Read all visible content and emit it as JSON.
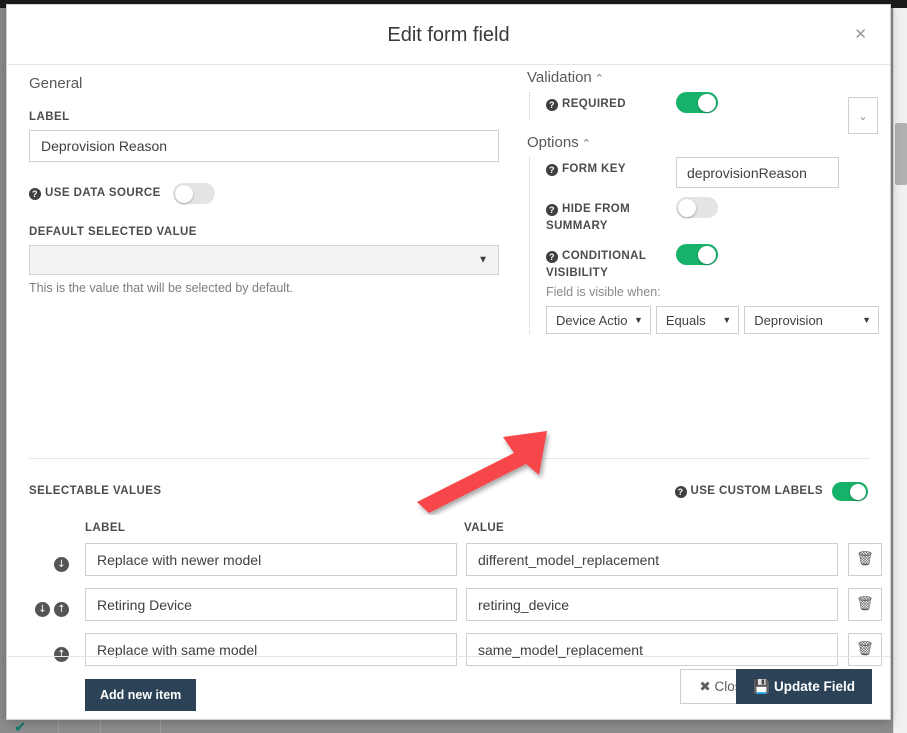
{
  "modal": {
    "title": "Edit form field",
    "close_icon": "close-x-icon"
  },
  "general": {
    "heading": "General",
    "label_caption": "LABEL",
    "label_value": "Deprovision Reason",
    "use_data_source_caption": "USE DATA SOURCE",
    "use_data_source_on": false,
    "default_selected_caption": "DEFAULT SELECTED VALUE",
    "default_selected_value": "",
    "default_selected_helper": "This is the value that will be selected by default.",
    "caret_icon": "▼"
  },
  "validation": {
    "heading": "Validation",
    "collapse_icon": "⌃",
    "required_caption": "REQUIRED",
    "required_on": true,
    "expand_icon": "⌄"
  },
  "options": {
    "heading": "Options",
    "collapse_icon": "⌃",
    "form_key_caption": "FORM KEY",
    "form_key_value": "deprovisionReason",
    "hide_from_summary_caption": "HIDE FROM SUMMARY",
    "hide_from_summary_on": false,
    "conditional_visibility_caption": "CONDITIONAL VISIBILITY",
    "conditional_visibility_on": true,
    "visible_when_text": "Field is visible when:",
    "condition": {
      "field": "Device Actio",
      "operator": "Equals",
      "value": "Deprovision",
      "caret_icon": "▼"
    }
  },
  "selectable_values": {
    "heading": "SELECTABLE VALUES",
    "use_custom_labels_caption": "USE CUSTOM LABELS",
    "use_custom_labels_on": true,
    "col_label": "LABEL",
    "col_value": "VALUE",
    "add_button": "Add new item",
    "trash_icon": "🗑",
    "rows": [
      {
        "label": "Replace with newer model",
        "value": "different_model_replacement",
        "move_down": true,
        "move_up": false
      },
      {
        "label": "Retiring Device",
        "value": "retiring_device",
        "move_down": true,
        "move_up": true
      },
      {
        "label": "Replace with same model",
        "value": "same_model_replacement",
        "move_down": false,
        "move_up": true
      }
    ],
    "down_icon": "↓",
    "up_icon": "↑"
  },
  "footer": {
    "close_label": "Close",
    "close_icon": "✖",
    "update_label": "Update Field",
    "update_icon": "💾"
  },
  "annotation": {
    "arrow_color": "#f7474b",
    "points_to": "condition-field-select"
  },
  "colors": {
    "toggle_on": "#17b26a",
    "primary_button": "#2b4257",
    "annotation_red": "#f7474b"
  }
}
